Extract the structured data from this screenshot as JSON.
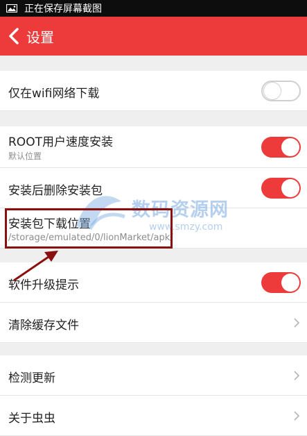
{
  "status_bar": {
    "text": "正在保存屏幕截图",
    "icon": "image-icon"
  },
  "app_bar": {
    "title": "设置",
    "back_icon": "back-arrow-icon"
  },
  "settings": {
    "wifi_only": {
      "label": "仅在wifi网络下载",
      "enabled": false
    },
    "root_install": {
      "label": "ROOT用户速度安装",
      "sublabel": "默认位置",
      "enabled": true
    },
    "delete_after_install": {
      "label": "安装后删除安装包",
      "enabled": true
    },
    "download_location": {
      "label": "安装包下载位置",
      "path": "/storage/emulated/0/lionMarket/apk/"
    },
    "upgrade_notice": {
      "label": "软件升级提示",
      "enabled": true
    },
    "clear_cache": {
      "label": "清除缓存文件"
    },
    "check_update": {
      "label": "检测更新"
    },
    "about": {
      "label": "关于虫虫"
    }
  },
  "watermark": {
    "text": "数码资源网",
    "url": "www.smzy.com"
  },
  "colors": {
    "accent": "#ed3b3b",
    "annotation": "#8a1010",
    "background": "#efefef"
  }
}
